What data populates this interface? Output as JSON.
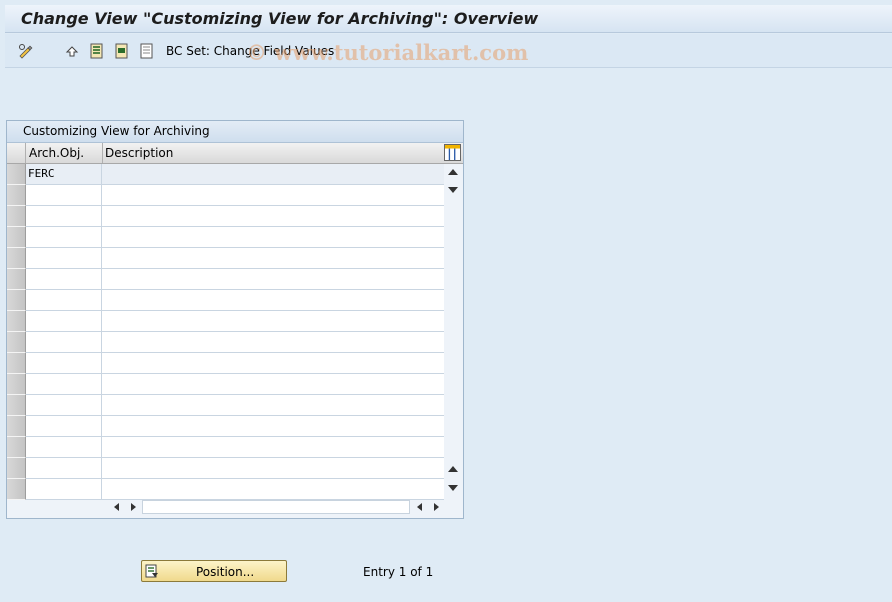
{
  "window": {
    "title": "Change View \"Customizing View for Archiving\": Overview"
  },
  "toolbar": {
    "icons": [
      "display-change-icon",
      "undo-icon",
      "select-all-icon",
      "select-block-icon",
      "deselect-all-icon"
    ],
    "bc_set_label": "BC Set: Change Field Values"
  },
  "watermark": "© www.tutorialkart.com",
  "table": {
    "title": "Customizing View for Archiving",
    "columns": [
      "Arch.Obj.",
      "Description"
    ],
    "rows": [
      {
        "arch_obj": "FERC",
        "description": ""
      }
    ],
    "visible_row_count": 16
  },
  "footer": {
    "position_button": "Position...",
    "entry_text": "Entry 1 of 1"
  },
  "colors": {
    "background": "#dfebf5",
    "button_gold": "#f0d98c",
    "title_text": "#1d1d1d"
  }
}
